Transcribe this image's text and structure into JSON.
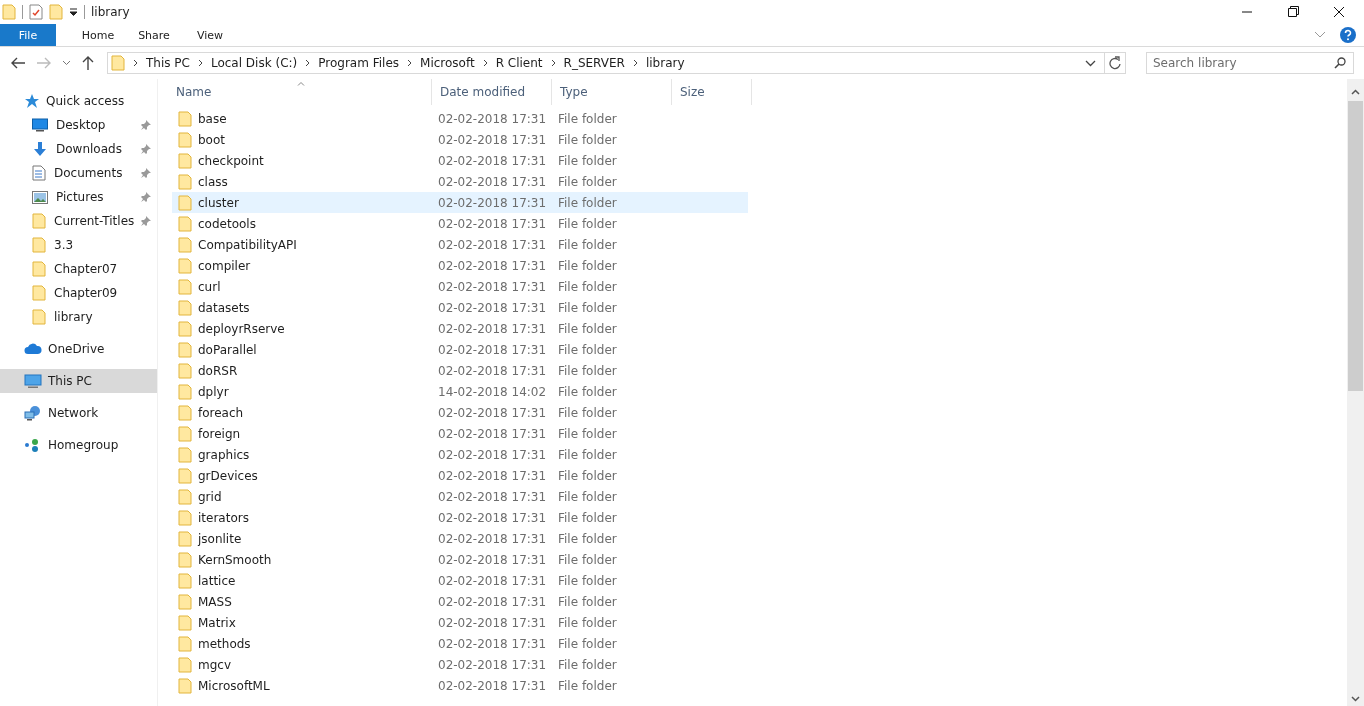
{
  "window": {
    "title": "library"
  },
  "ribbon": {
    "tabs": [
      {
        "label": "File",
        "selected": true
      },
      {
        "label": "Home",
        "selected": false
      },
      {
        "label": "Share",
        "selected": false
      },
      {
        "label": "View",
        "selected": false
      }
    ]
  },
  "address": {
    "crumbs": [
      "This PC",
      "Local Disk (C:)",
      "Program Files",
      "Microsoft",
      "R Client",
      "R_SERVER",
      "library"
    ]
  },
  "search": {
    "placeholder": "Search library"
  },
  "sidebar": {
    "items": [
      {
        "label": "Quick access",
        "kind": "star",
        "selected": false,
        "children": [
          {
            "label": "Desktop",
            "kind": "desktop",
            "pinned": true,
            "selected": false
          },
          {
            "label": "Downloads",
            "kind": "download",
            "pinned": true,
            "selected": false
          },
          {
            "label": "Documents",
            "kind": "documents",
            "pinned": true,
            "selected": false
          },
          {
            "label": "Pictures",
            "kind": "pictures",
            "pinned": true,
            "selected": false
          },
          {
            "label": "Current-Titles",
            "kind": "folder",
            "pinned": true,
            "selected": false
          },
          {
            "label": "3.3",
            "kind": "folder",
            "pinned": false,
            "selected": false
          },
          {
            "label": "Chapter07",
            "kind": "folder",
            "pinned": false,
            "selected": false
          },
          {
            "label": "Chapter09",
            "kind": "folder",
            "pinned": false,
            "selected": false
          },
          {
            "label": "library",
            "kind": "folder",
            "pinned": false,
            "selected": false
          }
        ]
      },
      {
        "label": "OneDrive",
        "kind": "cloud",
        "selected": false
      },
      {
        "label": "This PC",
        "kind": "pc",
        "selected": true
      },
      {
        "label": "Network",
        "kind": "network",
        "selected": false
      },
      {
        "label": "Homegroup",
        "kind": "homegroup",
        "selected": false
      }
    ]
  },
  "table": {
    "columns": [
      "Name",
      "Date modified",
      "Type",
      "Size"
    ],
    "rows": [
      {
        "name": "base",
        "date": "02-02-2018 17:31",
        "type": "File folder",
        "selected": false
      },
      {
        "name": "boot",
        "date": "02-02-2018 17:31",
        "type": "File folder",
        "selected": false
      },
      {
        "name": "checkpoint",
        "date": "02-02-2018 17:31",
        "type": "File folder",
        "selected": false
      },
      {
        "name": "class",
        "date": "02-02-2018 17:31",
        "type": "File folder",
        "selected": false
      },
      {
        "name": "cluster",
        "date": "02-02-2018 17:31",
        "type": "File folder",
        "selected": true
      },
      {
        "name": "codetools",
        "date": "02-02-2018 17:31",
        "type": "File folder",
        "selected": false
      },
      {
        "name": "CompatibilityAPI",
        "date": "02-02-2018 17:31",
        "type": "File folder",
        "selected": false
      },
      {
        "name": "compiler",
        "date": "02-02-2018 17:31",
        "type": "File folder",
        "selected": false
      },
      {
        "name": "curl",
        "date": "02-02-2018 17:31",
        "type": "File folder",
        "selected": false
      },
      {
        "name": "datasets",
        "date": "02-02-2018 17:31",
        "type": "File folder",
        "selected": false
      },
      {
        "name": "deployrRserve",
        "date": "02-02-2018 17:31",
        "type": "File folder",
        "selected": false
      },
      {
        "name": "doParallel",
        "date": "02-02-2018 17:31",
        "type": "File folder",
        "selected": false
      },
      {
        "name": "doRSR",
        "date": "02-02-2018 17:31",
        "type": "File folder",
        "selected": false
      },
      {
        "name": "dplyr",
        "date": "14-02-2018 14:02",
        "type": "File folder",
        "selected": false
      },
      {
        "name": "foreach",
        "date": "02-02-2018 17:31",
        "type": "File folder",
        "selected": false
      },
      {
        "name": "foreign",
        "date": "02-02-2018 17:31",
        "type": "File folder",
        "selected": false
      },
      {
        "name": "graphics",
        "date": "02-02-2018 17:31",
        "type": "File folder",
        "selected": false
      },
      {
        "name": "grDevices",
        "date": "02-02-2018 17:31",
        "type": "File folder",
        "selected": false
      },
      {
        "name": "grid",
        "date": "02-02-2018 17:31",
        "type": "File folder",
        "selected": false
      },
      {
        "name": "iterators",
        "date": "02-02-2018 17:31",
        "type": "File folder",
        "selected": false
      },
      {
        "name": "jsonlite",
        "date": "02-02-2018 17:31",
        "type": "File folder",
        "selected": false
      },
      {
        "name": "KernSmooth",
        "date": "02-02-2018 17:31",
        "type": "File folder",
        "selected": false
      },
      {
        "name": "lattice",
        "date": "02-02-2018 17:31",
        "type": "File folder",
        "selected": false
      },
      {
        "name": "MASS",
        "date": "02-02-2018 17:31",
        "type": "File folder",
        "selected": false
      },
      {
        "name": "Matrix",
        "date": "02-02-2018 17:31",
        "type": "File folder",
        "selected": false
      },
      {
        "name": "methods",
        "date": "02-02-2018 17:31",
        "type": "File folder",
        "selected": false
      },
      {
        "name": "mgcv",
        "date": "02-02-2018 17:31",
        "type": "File folder",
        "selected": false
      },
      {
        "name": "MicrosoftML",
        "date": "02-02-2018 17:31",
        "type": "File folder",
        "selected": false
      }
    ]
  }
}
